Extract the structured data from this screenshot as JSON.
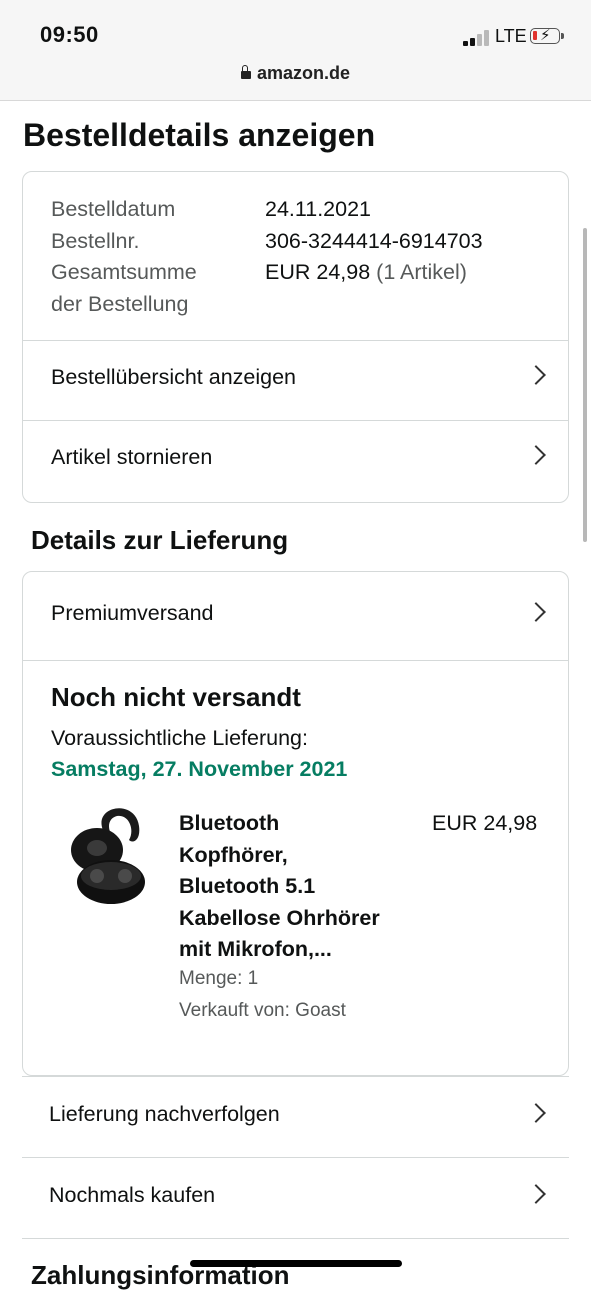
{
  "status_bar": {
    "time": "09:50",
    "network": "LTE",
    "url": "amazon.de"
  },
  "page_title": "Bestelldetails anzeigen",
  "order_summary": {
    "labels": [
      "Bestelldatum",
      "Bestellnr.",
      "Gesamtsumme",
      "der Bestellung"
    ],
    "date": "24.11.2021",
    "number": "306-3244414-6914703",
    "total": "EUR 24,98",
    "item_count": "(1 Artikel)",
    "links": [
      "Bestellübersicht anzeigen",
      "Artikel stornieren"
    ]
  },
  "delivery": {
    "section_title": "Details zur Lieferung",
    "shipping_method": "Premiumversand",
    "status": "Noch nicht versandt",
    "eta_label": "Voraussichtliche Lieferung:",
    "eta_date": "Samstag, 27. November 2021",
    "accent_color": "#067d62",
    "product": {
      "title_lines": [
        "Bluetooth",
        "Kopfhörer,",
        "Bluetooth 5.1",
        "Kabellose Ohrhörer",
        "mit Mikrofon,..."
      ],
      "price": "EUR 24,98",
      "quantity": "Menge: 1",
      "seller": "Verkauft von: Goast"
    }
  },
  "actions": [
    "Lieferung nachverfolgen",
    "Nochmals kaufen"
  ],
  "next_section_title": "Zahlungsinformation"
}
